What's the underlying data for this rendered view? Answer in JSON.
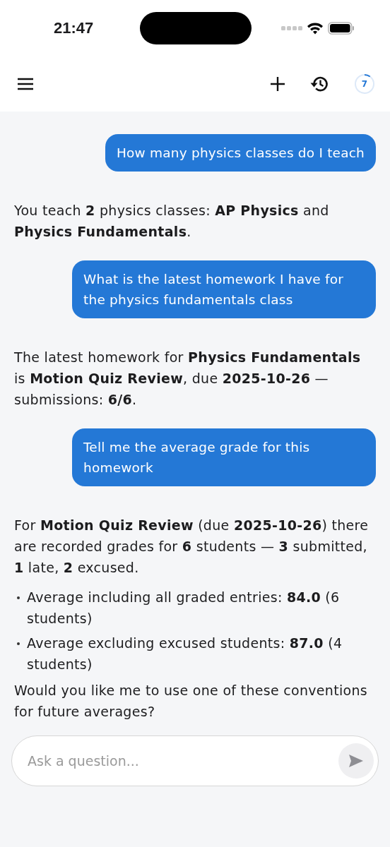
{
  "status_bar": {
    "time": "21:47"
  },
  "header": {
    "counter": {
      "value": "7",
      "level": 0.1
    }
  },
  "messages": [
    {
      "kind": "user",
      "text": "How many physics classes do I teach"
    },
    {
      "kind": "assistant",
      "blocks": [
        {
          "kind": "paragraph",
          "text": "You teach **2** physics classes: **AP Physics** and **Physics Fundamentals**."
        }
      ]
    },
    {
      "kind": "user",
      "text": "What is the latest homework I have for the physics fundamentals class"
    },
    {
      "kind": "assistant",
      "blocks": [
        {
          "kind": "paragraph",
          "text": "The latest homework for **Physics Fundamentals** is **Motion Quiz Review**, due **2025-10-26** — submissions: **6/6**."
        }
      ]
    },
    {
      "kind": "user",
      "text": "Tell me the average grade for this homework"
    },
    {
      "kind": "assistant",
      "blocks": [
        {
          "kind": "paragraph",
          "text": "For **Motion Quiz Review** (due **2025-10-26**) there are recorded grades for **6** students — **3** submitted, **1** late, **2** excused."
        },
        {
          "kind": "bullet",
          "text": "Average including all graded entries: **84.0** (6 students)"
        },
        {
          "kind": "bullet",
          "text": "Average excluding excused students: **87.0** (4 students)"
        },
        {
          "kind": "paragraph",
          "text": "Would you like me to use one of these conventions for future averages?"
        }
      ]
    }
  ],
  "composer": {
    "placeholder": "Ask a question..."
  }
}
